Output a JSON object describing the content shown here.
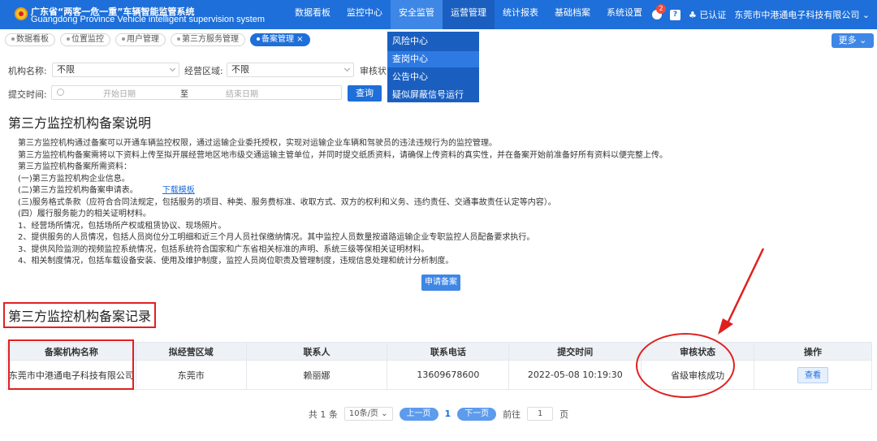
{
  "header": {
    "title_cn": "广东省“两客一危一重”车辆智能监管系统",
    "title_en": "Guangdong Province Vehicle intelligent supervision system",
    "nav": [
      "数据看板",
      "监控中心",
      "安全监管",
      "运营管理",
      "统计报表",
      "基础档案",
      "系统设置"
    ],
    "badge_count": "2",
    "help_label": "?",
    "auth_label": "已认证",
    "company": "东莞市中港通电子科技有限公司"
  },
  "tabs": [
    "数据看板",
    "位置监控",
    "用户管理",
    "第三方服务管理",
    "备案管理 ×"
  ],
  "more_label": "更多",
  "dropdown": [
    "风险中心",
    "查岗中心",
    "公告中心",
    "疑似屏蔽信号运行"
  ],
  "filters": {
    "org_label": "机构名称:",
    "org_value": "不限",
    "area_label": "经营区域:",
    "area_value": "不限",
    "status_label": "审核状",
    "submit_label": "提交时间:",
    "start_placeholder": "开始日期",
    "to_label": "至",
    "end_placeholder": "结束日期",
    "query_label": "查询"
  },
  "desc": {
    "title": "第三方监控机构备案说明",
    "lines": [
      "第三方监控机构通过备案可以开通车辆监控权限，通过运输企业委托授权，实现对运输企业车辆和驾驶员的违法违规行为的监控管理。",
      "第三方监控机构备案需将以下资料上传至拟开展经营地区地市级交通运输主管单位，并同时提交纸质资料，请确保上传资料的真实性，并在备案开始前准备好所有资料以便完整上传。",
      "第三方监控机构备案所需资料：",
      "(一)第三方监控机构企业信息。",
      "(二)第三方监控机构备案申请表。",
      "(三)服务格式条款（应符合合同法规定，包括服务的项目、种类、服务费标准、收取方式、双方的权利和义务、违约责任、交通事故责任认定等内容）。",
      "(四）履行服务能力的相关证明材料。",
      "1、经营场所情况，包括场所产权或租赁协议、现场照片。",
      "2、提供服务的人员情况，包括人员岗位分工明细和近三个月人员社保缴纳情况。其中监控人员数量按道路运输企业专职监控人员配备要求执行。",
      "3、提供风险监测的视频监控系统情况，包括系统符合国家和广东省相关标准的声明、系统三级等保相关证明材料。",
      "4、相关制度情况，包括车载设备安装、使用及维护制度，监控人员岗位职责及管理制度，违规信息处理和统计分析制度。"
    ],
    "download_link": "下载模板",
    "apply_label": "申请备案"
  },
  "records": {
    "title": "第三方监控机构备案记录",
    "columns": [
      "备案机构名称",
      "拟经营区域",
      "联系人",
      "联系电话",
      "提交时间",
      "审核状态",
      "操作"
    ],
    "rows": [
      [
        "东莞市中港通电子科技有限公司",
        "东莞市",
        "赖丽娜",
        "13609678600",
        "2022-05-08 10:19:30",
        "省级审核成功",
        "查看"
      ]
    ]
  },
  "pager": {
    "total": "共 1 条",
    "page_size": "10条/页",
    "prev": "上一页",
    "current": "1",
    "next": "下一页",
    "goto_label": "前往",
    "goto_value": "1",
    "page_suffix": "页"
  },
  "colors": {
    "header_blue": "#1e6fd9",
    "annotation_red": "#e02020"
  }
}
